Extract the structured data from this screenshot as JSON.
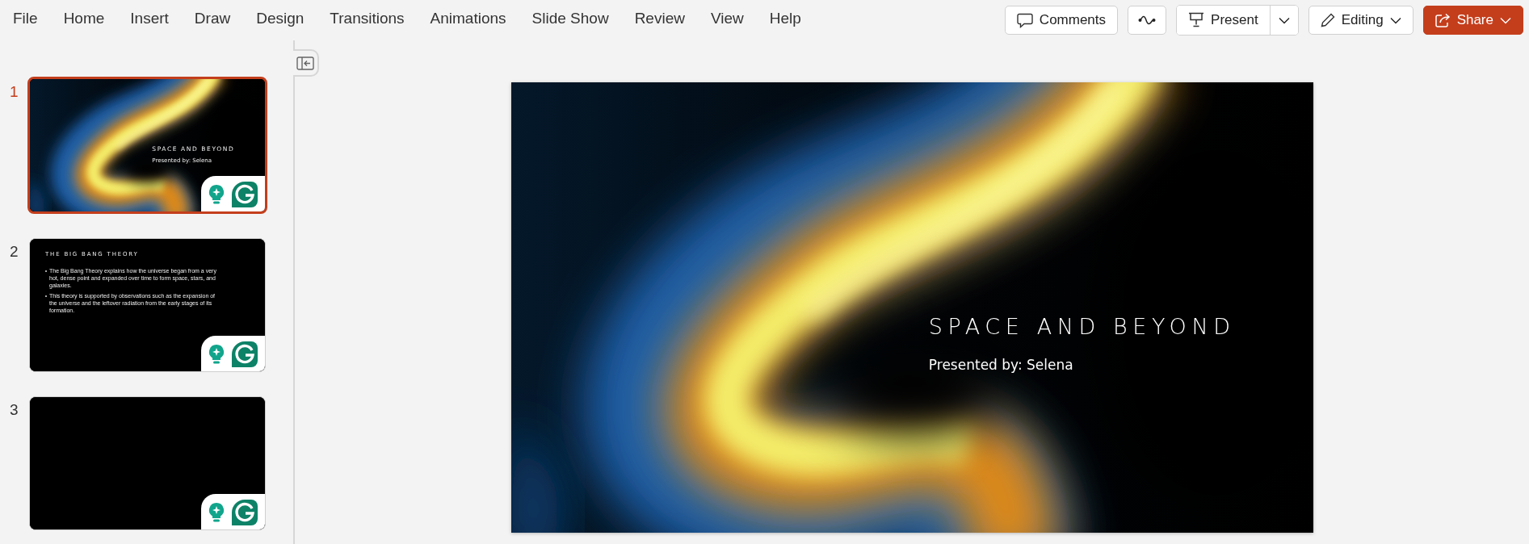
{
  "menu": [
    {
      "label": "File",
      "selected": false
    },
    {
      "label": "Home",
      "selected": false
    },
    {
      "label": "Insert",
      "selected": false
    },
    {
      "label": "Draw",
      "selected": false
    },
    {
      "label": "Design",
      "selected": false
    },
    {
      "label": "Transitions",
      "selected": false
    },
    {
      "label": "Animations",
      "selected": false
    },
    {
      "label": "Slide Show",
      "selected": false
    },
    {
      "label": "Review",
      "selected": false
    },
    {
      "label": "View",
      "selected": false
    },
    {
      "label": "Help",
      "selected": false
    }
  ],
  "actions": {
    "comments": "Comments",
    "present": "Present",
    "editing": "Editing",
    "share": "Share"
  },
  "slides": [
    {
      "number": "1",
      "kind": "title",
      "selected": true,
      "title": "SPACE AND BEYOND",
      "subtitle": "Presented by: Selena"
    },
    {
      "number": "2",
      "kind": "content",
      "selected": false,
      "title": "THE BIG BANG THEORY",
      "bullets": [
        "The Big Bang Theory explains how the universe began from a very hot, dense point and expanded over time to form space, stars, and galaxies.",
        "This theory is supported by observations such as the expansion of the universe and the leftover radiation from the early stages of its formation."
      ]
    },
    {
      "number": "3",
      "kind": "blank",
      "selected": false
    }
  ],
  "current_slide": {
    "kind": "picture",
    "title": "SPACE AND BEYOND",
    "subtitle": "Presented by: Selena"
  }
}
